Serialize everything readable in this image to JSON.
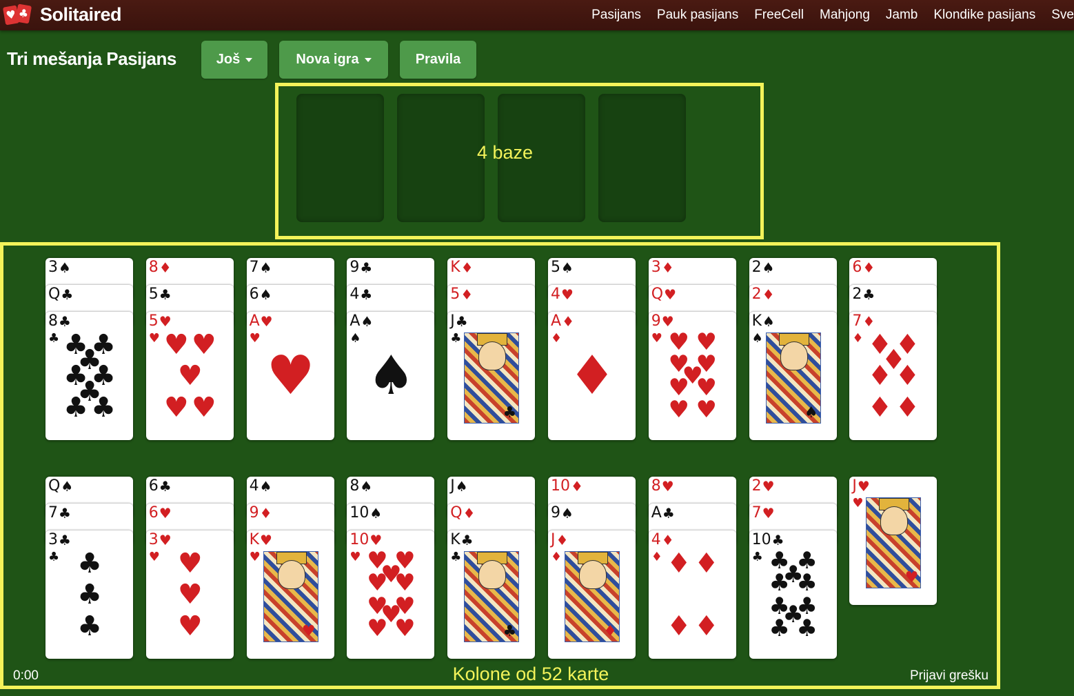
{
  "header": {
    "logo_text": "Solitaired",
    "logo_suits": [
      "♥",
      "♣"
    ],
    "nav": [
      "Pasijans",
      "Pauk pasijans",
      "FreeCell",
      "Mahjong",
      "Jamb",
      "Klondike pasijans",
      "Sve"
    ]
  },
  "toolbar": {
    "title": "Tri mešanja Pasijans",
    "more_label": "Još",
    "new_game_label": "Nova igra",
    "rules_label": "Pravila"
  },
  "annotations": {
    "foundations": "4 baze",
    "tableau": "Kolone od 52 karte"
  },
  "footer": {
    "timer": "0:00",
    "report": "Prijavi grešku"
  },
  "colors": {
    "felt": "#1f5416",
    "highlight": "#f3f35a",
    "button": "#4e9a4a",
    "red_suit": "#d21f22"
  },
  "tableau": {
    "row1": [
      [
        "3♠",
        "Q♣",
        "8♣"
      ],
      [
        "8♦",
        "5♣",
        "5♥"
      ],
      [
        "7♠",
        "6♠",
        "A♥"
      ],
      [
        "9♣",
        "4♣",
        "A♠"
      ],
      [
        "K♦",
        "5♦",
        "J♣"
      ],
      [
        "5♠",
        "4♥",
        "A♦"
      ],
      [
        "3♦",
        "Q♥",
        "9♥"
      ],
      [
        "2♠",
        "2♦",
        "K♠"
      ],
      [
        "6♦",
        "2♣",
        "7♦"
      ]
    ],
    "row2": [
      [
        "Q♠",
        "7♣",
        "3♣"
      ],
      [
        "6♣",
        "6♥",
        "3♥"
      ],
      [
        "4♠",
        "9♦",
        "K♥"
      ],
      [
        "8♠",
        "10♠",
        "10♥"
      ],
      [
        "J♠",
        "Q♦",
        "K♣"
      ],
      [
        "10♦",
        "9♠",
        "J♦"
      ],
      [
        "8♥",
        "A♣",
        "4♦"
      ],
      [
        "2♥",
        "7♥",
        "10♣"
      ],
      [
        "J♥"
      ]
    ]
  }
}
